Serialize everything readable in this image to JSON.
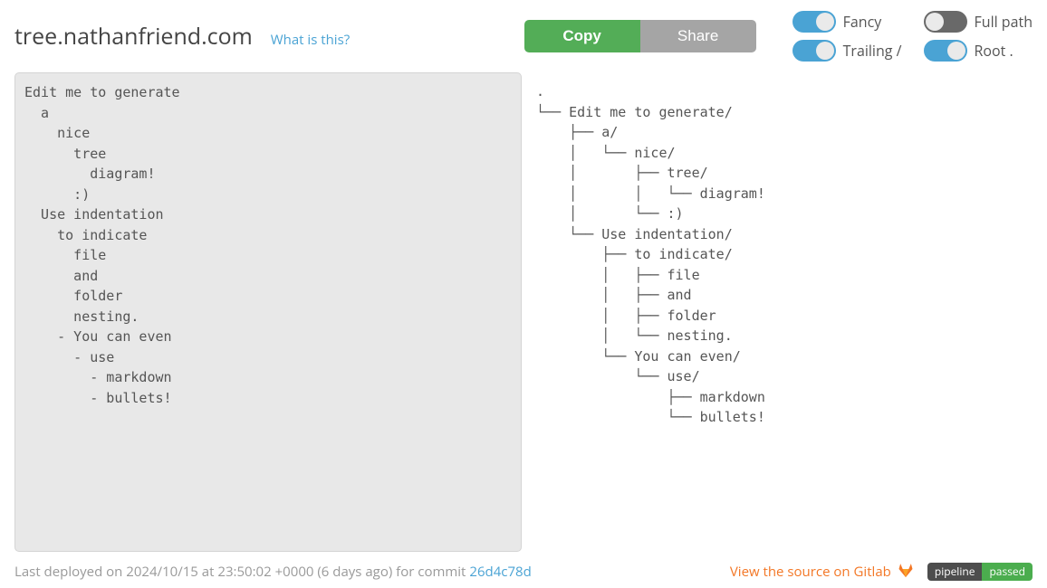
{
  "header": {
    "title": "tree.nathanfriend.com",
    "what_link": "What is this?",
    "copy_label": "Copy",
    "share_label": "Share"
  },
  "toggles": {
    "fancy": {
      "label": "Fancy",
      "on": true
    },
    "fullpath": {
      "label": "Full path",
      "on": false
    },
    "trailing": {
      "label": "Trailing /",
      "on": true
    },
    "root": {
      "label": "Root .",
      "on": true
    }
  },
  "input_text": "Edit me to generate\n  a\n    nice\n      tree\n        diagram!\n      :)\n  Use indentation\n    to indicate\n      file\n      and\n      folder\n      nesting.\n    - You can even\n      - use\n        - markdown\n        - bullets!",
  "output_text": ".\n└── Edit me to generate/\n    ├── a/\n    │   └── nice/\n    │       ├── tree/\n    │       │   └── diagram!\n    │       └── :)\n    └── Use indentation/\n        ├── to indicate/\n        │   ├── file\n        │   ├── and\n        │   ├── folder\n        │   └── nesting.\n        └── You can even/\n            └── use/\n                ├── markdown\n                └── bullets!",
  "footer": {
    "deploy_text": "Last deployed on 2024/10/15 at 23:50:02 +0000 (6 days ago) for commit",
    "commit": "26d4c78d",
    "view_source": "View the source on Gitlab",
    "pipeline_label": "pipeline",
    "pipeline_status": "passed"
  }
}
